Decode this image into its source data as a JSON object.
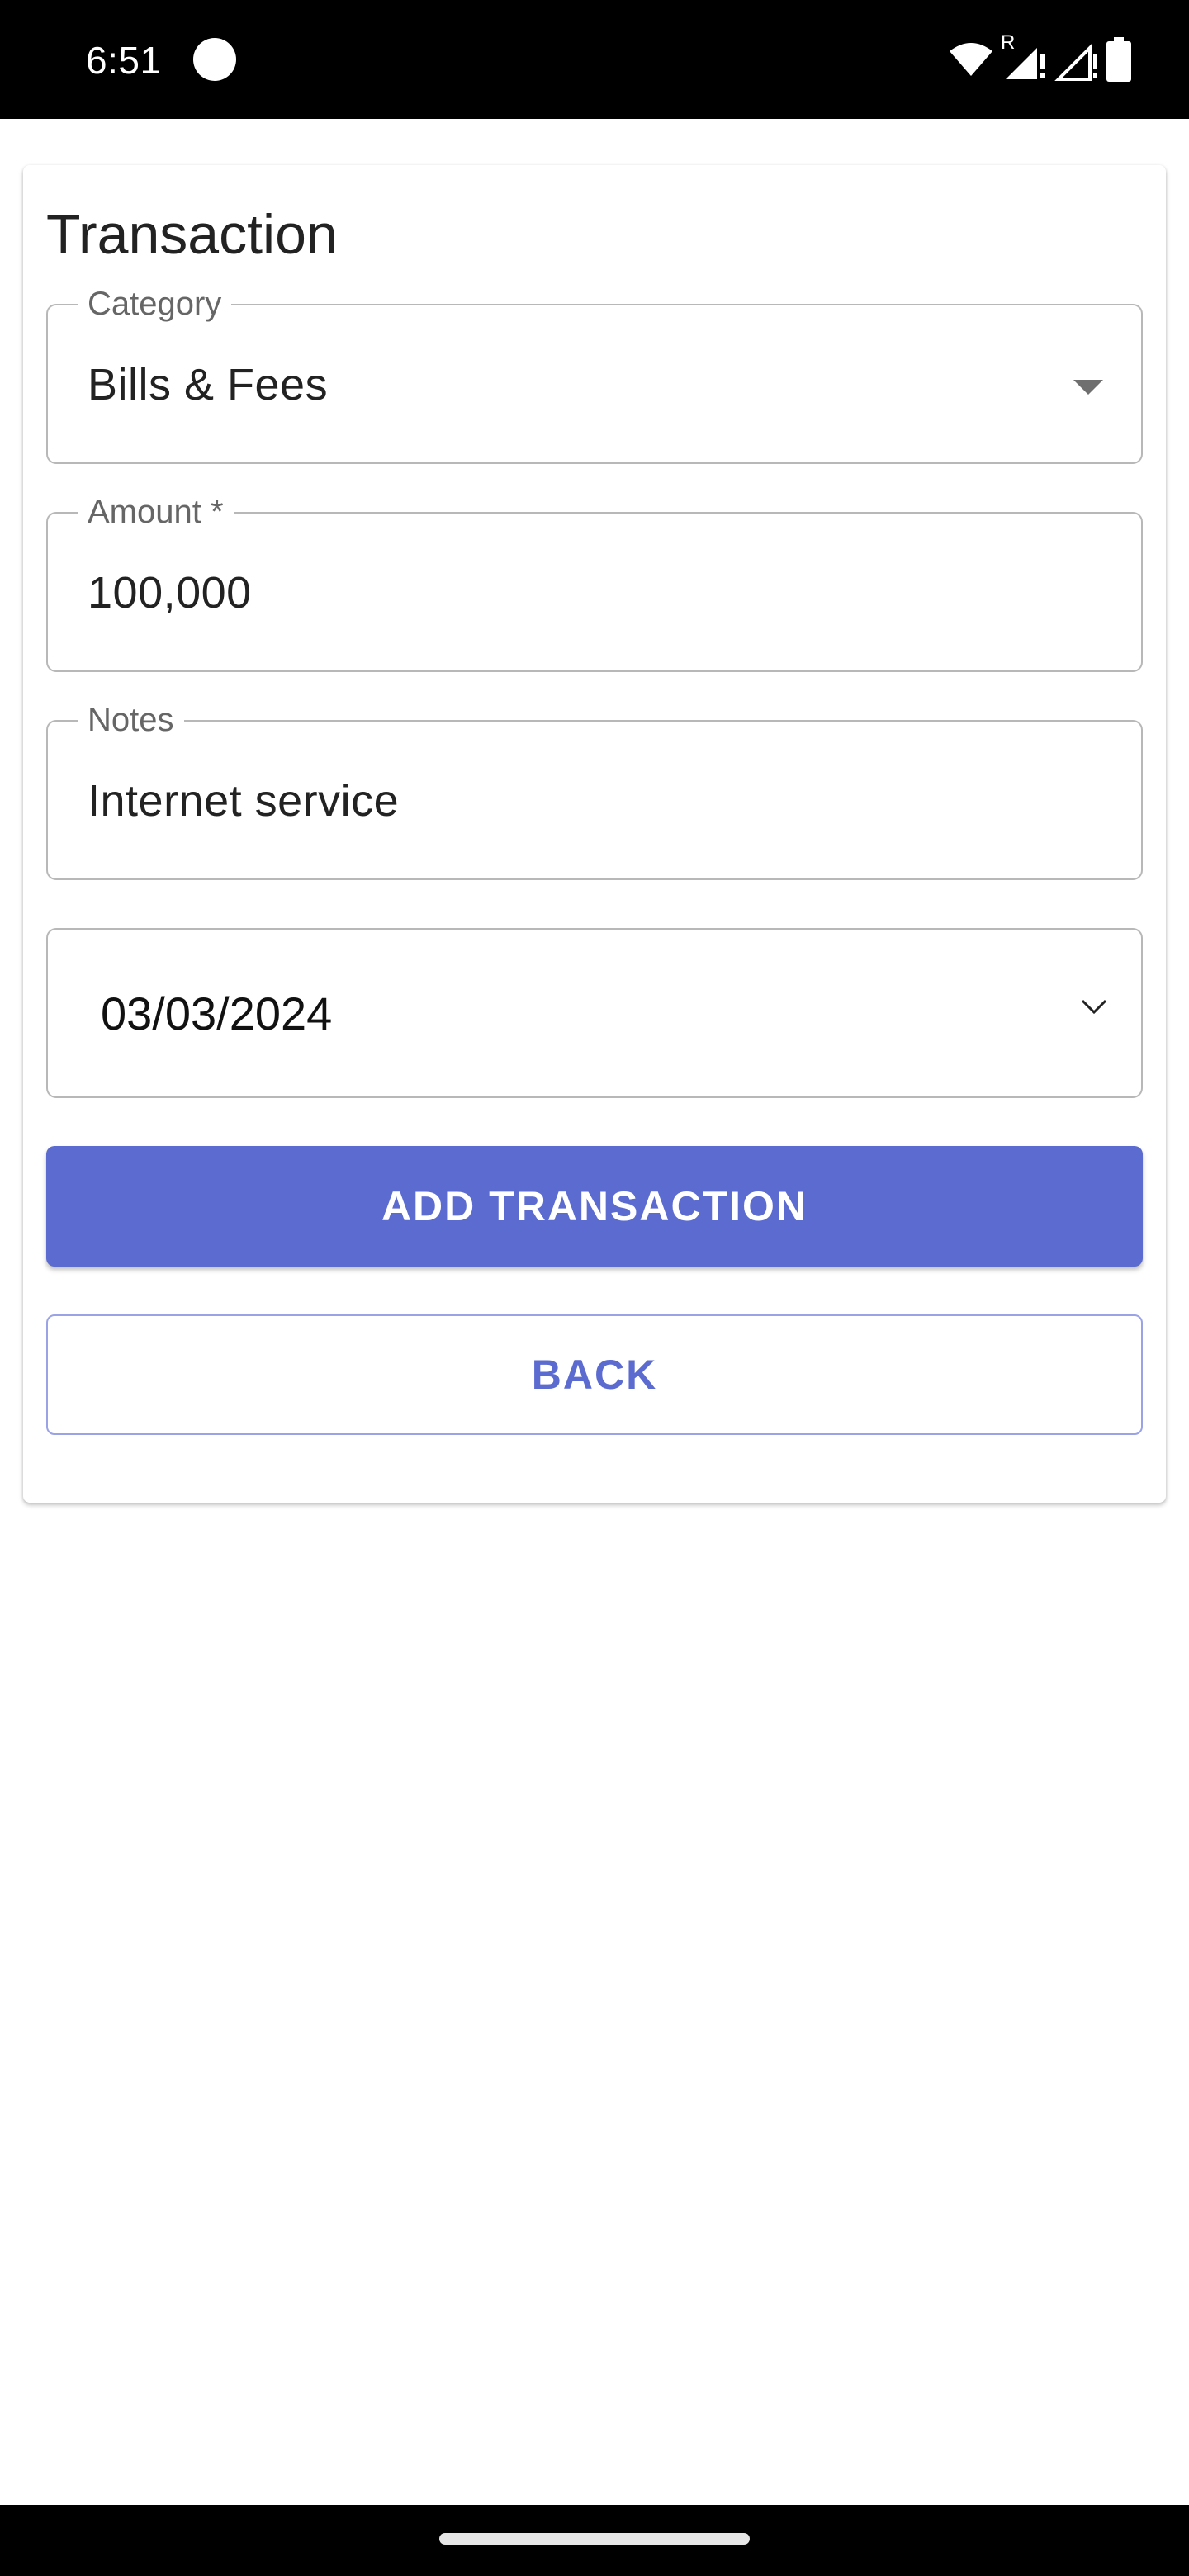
{
  "status_bar": {
    "time": "6:51",
    "icons": [
      "record-dot-icon",
      "wifi-icon",
      "signal-roaming-icon",
      "signal-icon",
      "battery-icon"
    ],
    "roaming_mark": "R"
  },
  "form": {
    "title": "Transaction",
    "category": {
      "label": "Category",
      "value": "Bills & Fees"
    },
    "amount": {
      "label": "Amount *",
      "value": "100,000"
    },
    "notes": {
      "label": "Notes",
      "value": "Internet service"
    },
    "date": {
      "value": "03/03/2024"
    },
    "add_button_label": "ADD TRANSACTION",
    "back_button_label": "BACK"
  },
  "colors": {
    "primary": "#5b6bd0",
    "status_bar_bg": "#000000",
    "outline": "#b8b8b8"
  }
}
